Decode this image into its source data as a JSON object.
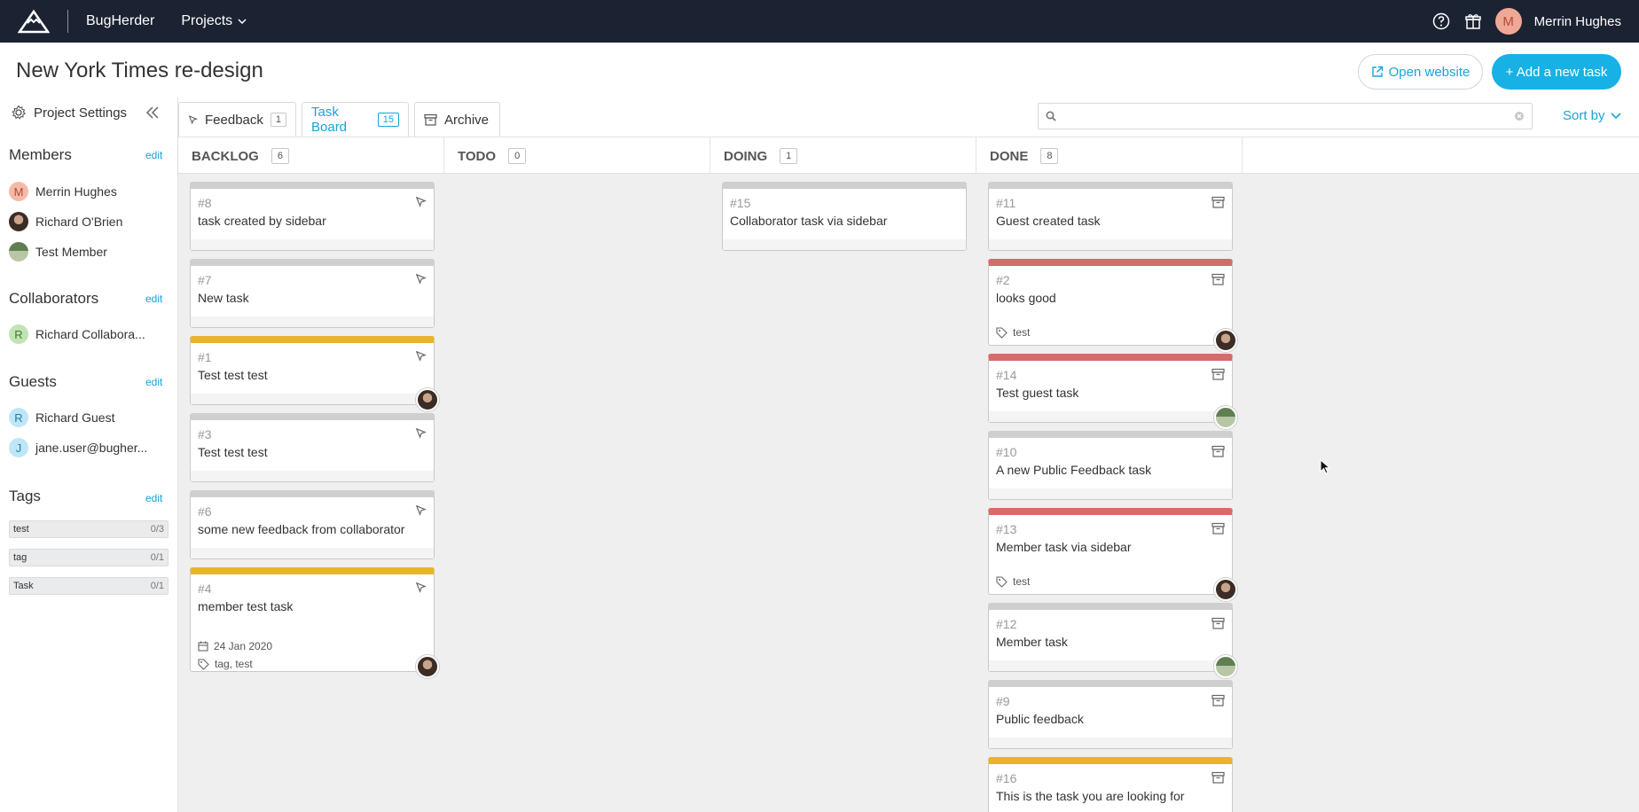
{
  "topbar": {
    "brand": "BugHerder",
    "projects_label": "Projects",
    "user_initial": "M",
    "user_name": "Merrin Hughes"
  },
  "header": {
    "project_title": "New York Times re-design",
    "open_website_label": "Open website",
    "add_task_label": "+ Add a new task"
  },
  "sidebar": {
    "settings_label": "Project Settings",
    "members_title": "Members",
    "collaborators_title": "Collaborators",
    "guests_title": "Guests",
    "tags_title": "Tags",
    "edit_label": "edit",
    "members": [
      {
        "initial": "M",
        "name": "Merrin Hughes"
      },
      {
        "initial": "",
        "name": "Richard O'Brien"
      },
      {
        "initial": "",
        "name": "Test Member"
      }
    ],
    "collaborators": [
      {
        "initial": "R",
        "name": "Richard Collabora..."
      }
    ],
    "guests": [
      {
        "initial": "R",
        "name": "Richard Guest"
      },
      {
        "initial": "J",
        "name": "jane.user@bugher..."
      }
    ],
    "tags": [
      {
        "name": "test",
        "count": "0/3"
      },
      {
        "name": "tag",
        "count": "0/1"
      },
      {
        "name": "Task",
        "count": "0/1"
      }
    ]
  },
  "tabs": [
    {
      "label": "Feedback",
      "count": "1"
    },
    {
      "label": "Task Board",
      "count": "15"
    },
    {
      "label": "Archive",
      "count": ""
    }
  ],
  "search": {
    "placeholder": ""
  },
  "sort_label": "Sort by",
  "columns": [
    {
      "title": "BACKLOG",
      "count": "6"
    },
    {
      "title": "TODO",
      "count": "0"
    },
    {
      "title": "DOING",
      "count": "1"
    },
    {
      "title": "DONE",
      "count": "8"
    }
  ],
  "cards": {
    "backlog": [
      {
        "num": "#8",
        "title": "task created by sidebar"
      },
      {
        "num": "#7",
        "title": "New task"
      },
      {
        "num": "#1",
        "title": "Test test test"
      },
      {
        "num": "#3",
        "title": "Test test test"
      },
      {
        "num": "#6",
        "title": "some new feedback from collaborator"
      },
      {
        "num": "#4",
        "title": "member test task",
        "date": "24 Jan 2020",
        "tags": "tag, test"
      }
    ],
    "doing": [
      {
        "num": "#15",
        "title": "Collaborator task via sidebar"
      }
    ],
    "done": [
      {
        "num": "#11",
        "title": "Guest created task"
      },
      {
        "num": "#2",
        "title": "looks good",
        "tags": "test"
      },
      {
        "num": "#14",
        "title": "Test guest task"
      },
      {
        "num": "#10",
        "title": "A new Public Feedback task"
      },
      {
        "num": "#13",
        "title": "Member task via sidebar",
        "tags": "test"
      },
      {
        "num": "#12",
        "title": "Member task"
      },
      {
        "num": "#9",
        "title": "Public feedback"
      },
      {
        "num": "#16",
        "title": "This is the task you are looking for"
      }
    ]
  },
  "colors": {
    "topbar": "#1b2232",
    "accent": "#17b1e5",
    "yellow_stripe": "#e8b52a",
    "red_stripe": "#d86a6a",
    "grey_stripe": "#cfcfcf"
  }
}
